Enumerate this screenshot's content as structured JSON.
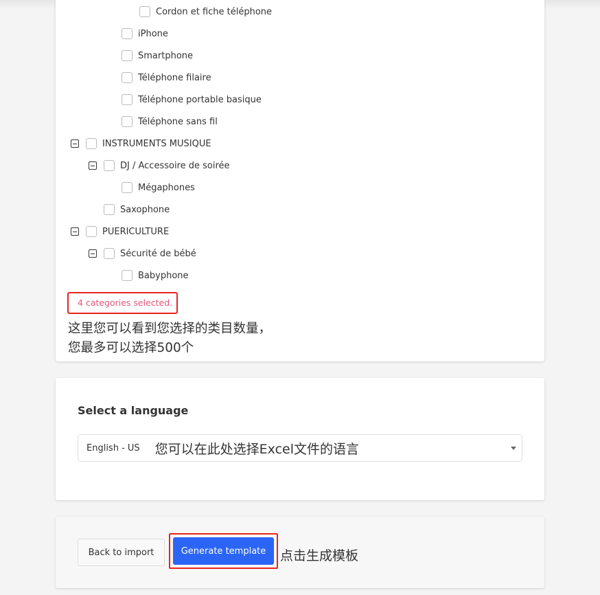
{
  "tree": [
    {
      "label": "Cordon et fiche téléphone",
      "level": 3,
      "toggle": false
    },
    {
      "label": "iPhone",
      "level": 2,
      "toggle": false
    },
    {
      "label": "Smartphone",
      "level": 2,
      "toggle": false
    },
    {
      "label": "Téléphone filaire",
      "level": 2,
      "toggle": false
    },
    {
      "label": "Téléphone portable basique",
      "level": 2,
      "toggle": false
    },
    {
      "label": "Téléphone sans fil",
      "level": 2,
      "toggle": false
    },
    {
      "label": "INSTRUMENTS MUSIQUE",
      "level": 0,
      "toggle": true
    },
    {
      "label": "DJ / Accessoire de soirée",
      "level": 1,
      "toggle": true
    },
    {
      "label": "Mégaphones",
      "level": 2,
      "toggle": false
    },
    {
      "label": "Saxophone",
      "level": 1,
      "toggle": false
    },
    {
      "label": "PUERICULTURE",
      "level": 0,
      "toggle": true
    },
    {
      "label": "Sécurité de bébé",
      "level": 1,
      "toggle": true
    },
    {
      "label": "Babyphone",
      "level": 2,
      "toggle": false
    }
  ],
  "selected_count_text": "4 categories selected.",
  "annotation_count_line1": "这里您可以看到您选择的类目数量，",
  "annotation_count_line2": "您最多可以选择500个",
  "language": {
    "heading": "Select a language",
    "value": "English - US",
    "annotation": "您可以在此处选择Excel文件的语言"
  },
  "actions": {
    "back": "Back to import",
    "generate": "Generate template",
    "annotation": "点击生成模板"
  },
  "colors": {
    "primary": "#2b65f5",
    "highlight_box": "#e8231e",
    "selected_text": "#e8567a"
  }
}
